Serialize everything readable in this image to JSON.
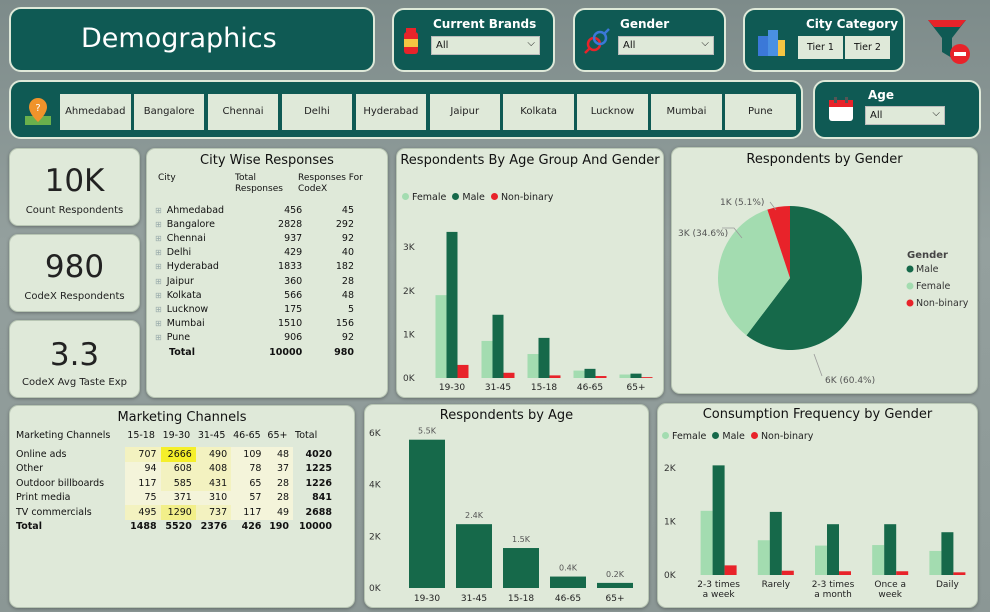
{
  "title": "Demographics",
  "filters": {
    "brands": {
      "label": "Current Brands",
      "value": "All"
    },
    "gender": {
      "label": "Gender",
      "value": "All"
    },
    "city_category": {
      "label": "City Category",
      "tiers": [
        "Tier 1",
        "Tier 2"
      ]
    },
    "age": {
      "label": "Age",
      "value": "All"
    }
  },
  "cities": [
    "Ahmedabad",
    "Bangalore",
    "Chennai",
    "Delhi",
    "Hyderabad",
    "Jaipur",
    "Kolkata",
    "Lucknow",
    "Mumbai",
    "Pune"
  ],
  "kpis": [
    {
      "value": "10K",
      "label": "Count Respondents"
    },
    {
      "value": "980",
      "label": "CodeX Respondents"
    },
    {
      "value": "3.3",
      "label": "CodeX Avg Taste Exp"
    }
  ],
  "colors": {
    "female": "#a3dcb0",
    "male": "#16694a",
    "nonbinary": "#e8232a",
    "highlight": "#f5ef2a",
    "dark": "#0f5a54"
  },
  "city_table": {
    "title": "City Wise Responses",
    "headers": [
      "City",
      "Total Responses",
      "Responses For CodeX"
    ],
    "rows": [
      [
        "Ahmedabad",
        "456",
        "45"
      ],
      [
        "Bangalore",
        "2828",
        "292"
      ],
      [
        "Chennai",
        "937",
        "92"
      ],
      [
        "Delhi",
        "429",
        "40"
      ],
      [
        "Hyderabad",
        "1833",
        "182"
      ],
      [
        "Jaipur",
        "360",
        "28"
      ],
      [
        "Kolkata",
        "566",
        "48"
      ],
      [
        "Lucknow",
        "175",
        "5"
      ],
      [
        "Mumbai",
        "1510",
        "156"
      ],
      [
        "Pune",
        "906",
        "92"
      ]
    ],
    "total": [
      "Total",
      "10000",
      "980"
    ]
  },
  "marketing_table": {
    "title": "Marketing Channels",
    "headers": [
      "Marketing Channels",
      "15-18",
      "19-30",
      "31-45",
      "46-65",
      "65+",
      "Total"
    ],
    "rows": [
      [
        "Online ads",
        "707",
        "2666",
        "490",
        "109",
        "48",
        "4020"
      ],
      [
        "Other",
        "94",
        "608",
        "408",
        "78",
        "37",
        "1225"
      ],
      [
        "Outdoor billboards",
        "117",
        "585",
        "431",
        "65",
        "28",
        "1226"
      ],
      [
        "Print media",
        "75",
        "371",
        "310",
        "57",
        "28",
        "841"
      ],
      [
        "TV commercials",
        "495",
        "1290",
        "737",
        "117",
        "49",
        "2688"
      ]
    ],
    "total": [
      "Total",
      "1488",
      "5520",
      "2376",
      "426",
      "190",
      "10000"
    ]
  },
  "legend": {
    "female": "Female",
    "male": "Male",
    "nonbinary": "Non-binary"
  },
  "chart_data": [
    {
      "type": "bar",
      "title": "Respondents By Age Group And Gender",
      "categories": [
        "19-30",
        "31-45",
        "15-18",
        "46-65",
        "65+"
      ],
      "series": [
        {
          "name": "Female",
          "values": [
            1900,
            850,
            550,
            170,
            80
          ]
        },
        {
          "name": "Male",
          "values": [
            3350,
            1450,
            920,
            210,
            100
          ]
        },
        {
          "name": "Non-binary",
          "values": [
            300,
            120,
            60,
            45,
            20
          ]
        }
      ],
      "yticks": [
        "0K",
        "1K",
        "2K",
        "3K"
      ],
      "ylim": [
        0,
        3600
      ]
    },
    {
      "type": "pie",
      "title": "Respondents by Gender",
      "legend_title": "Gender",
      "slices": [
        {
          "name": "Male",
          "value": 60.4,
          "label": "6K (60.4%)"
        },
        {
          "name": "Female",
          "value": 34.6,
          "label": "3K (34.6%)"
        },
        {
          "name": "Non-binary",
          "value": 5.1,
          "label": "1K (5.1%)"
        }
      ]
    },
    {
      "type": "bar",
      "title": "Respondents by Age",
      "categories": [
        "19-30",
        "31-45",
        "15-18",
        "46-65",
        "65+"
      ],
      "values": [
        5520,
        2376,
        1488,
        426,
        190
      ],
      "data_labels": [
        "5.5K",
        "2.4K",
        "1.5K",
        "0.4K",
        "0.2K"
      ],
      "yticks": [
        "0K",
        "2K",
        "4K",
        "6K"
      ],
      "ylim": [
        0,
        6000
      ]
    },
    {
      "type": "bar",
      "title": "Consumption Frequency by Gender",
      "categories": [
        "2-3 times a week",
        "Rarely",
        "2-3 times a month",
        "Once a week",
        "Daily"
      ],
      "series": [
        {
          "name": "Female",
          "values": [
            1200,
            650,
            550,
            560,
            450
          ]
        },
        {
          "name": "Male",
          "values": [
            2050,
            1180,
            950,
            950,
            800
          ]
        },
        {
          "name": "Non-binary",
          "values": [
            180,
            80,
            70,
            70,
            50
          ]
        }
      ],
      "yticks": [
        "0K",
        "1K",
        "2K"
      ],
      "ylim": [
        0,
        2300
      ]
    }
  ]
}
